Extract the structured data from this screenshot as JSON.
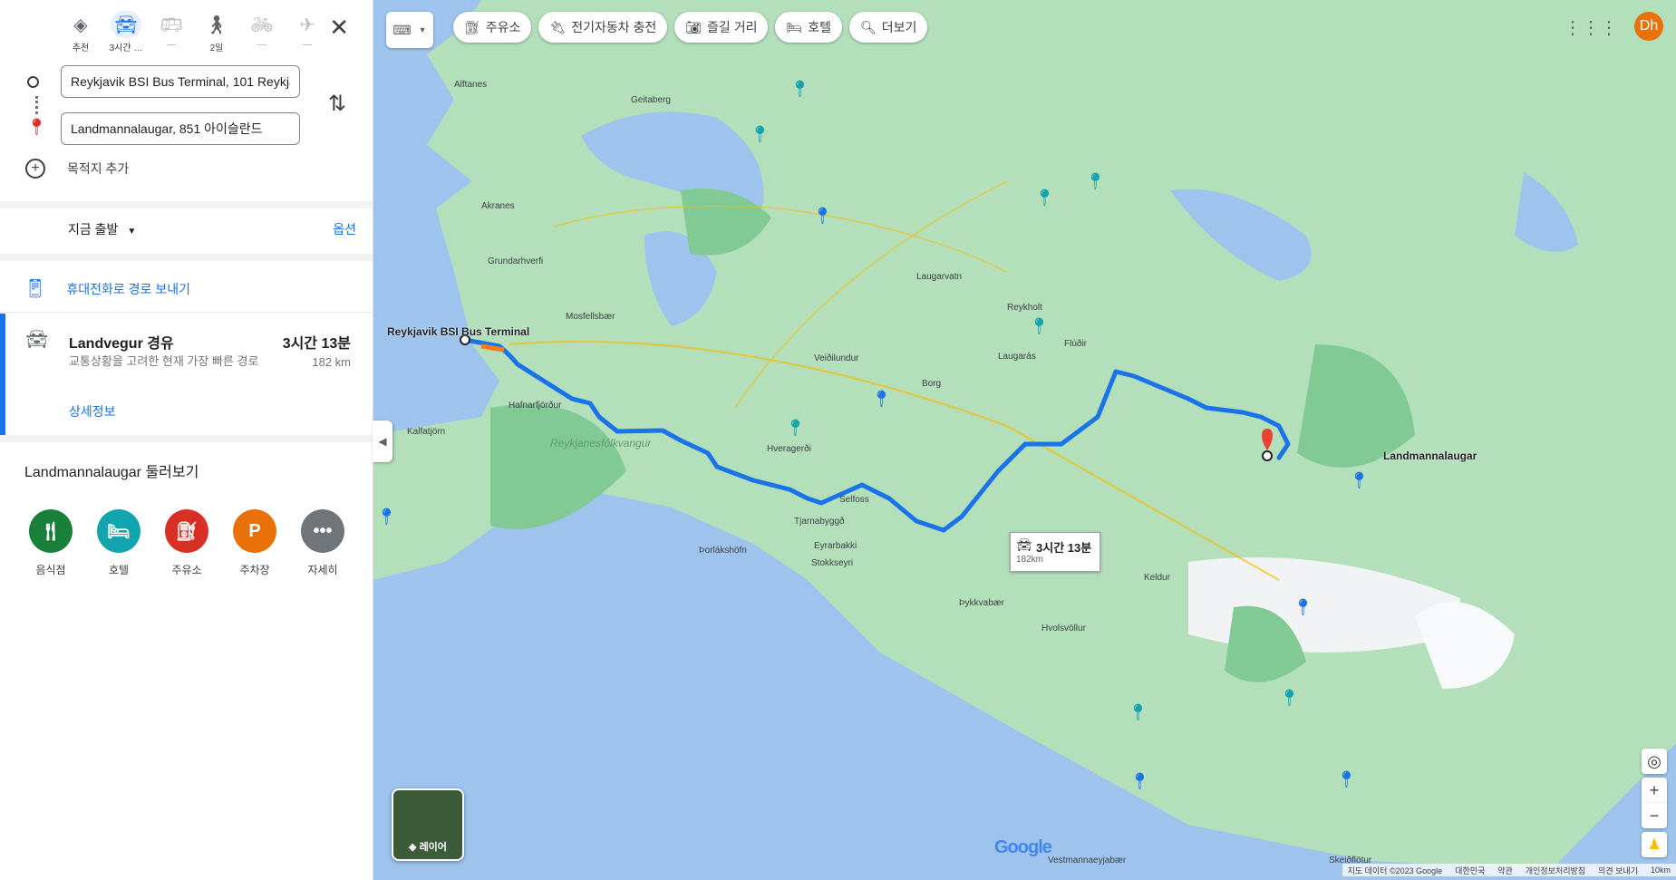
{
  "modes": [
    {
      "name": "best",
      "icon": "diamond-directions-icon",
      "label": "추천"
    },
    {
      "name": "driving",
      "icon": "car-icon",
      "label": "3시간 …"
    },
    {
      "name": "transit",
      "icon": "bus-icon",
      "label": "—"
    },
    {
      "name": "walking",
      "icon": "walking-icon",
      "label": "2일"
    },
    {
      "name": "cycling",
      "icon": "bicycle-icon",
      "label": "—"
    },
    {
      "name": "flight",
      "icon": "airplane-icon",
      "label": "—"
    }
  ],
  "waypoints": {
    "origin": "Reykjavik BSI Bus Terminal, 101 Reykjavík",
    "destination": "Landmannalaugar, 851 아이슬란드"
  },
  "add_destination": "목적지 추가",
  "depart": "지금 출발",
  "options": "옵션",
  "send_to_phone": "휴대전화로 경로 보내기",
  "route": {
    "name": "Landvegur 경유",
    "time": "3시간 13분",
    "distance": "182 km",
    "description": "교통상황을 고려한 현재 가장 빠른 경로",
    "details": "상세정보"
  },
  "explore": {
    "title": "Landmannalaugar 둘러보기",
    "categories": [
      {
        "label": "음식점",
        "color": "#188038",
        "icon": "fork-knife-icon"
      },
      {
        "label": "호텔",
        "color": "#12a4af",
        "icon": "bed-icon"
      },
      {
        "label": "주유소",
        "color": "#d93025",
        "icon": "fuel-icon"
      },
      {
        "label": "주차장",
        "color": "#e8710a",
        "icon": "parking-icon"
      },
      {
        "label": "자세히",
        "color": "#70757a",
        "icon": "more-icon"
      }
    ]
  },
  "chips": [
    {
      "label": "주유소",
      "icon": "fuel-icon"
    },
    {
      "label": "전기자동차 충전",
      "icon": "ev-charger-icon"
    },
    {
      "label": "즐길 거리",
      "icon": "camera-icon"
    },
    {
      "label": "호텔",
      "icon": "bed-icon"
    },
    {
      "label": "더보기",
      "icon": "search-icon"
    }
  ],
  "avatar": "Dh",
  "layers_label": "레이어",
  "tooltip": {
    "time": "3시간 13분",
    "distance": "182km"
  },
  "map_labels": {
    "origin": "Reykjavik BSI Bus Terminal",
    "destination": "Landmannalaugar",
    "places": [
      "Alftanes",
      "Akranes",
      "Mosfellsbær",
      "Hafnarfjörður",
      "Reykjanesfólkvangur",
      "Hveragerði",
      "Selfoss",
      "Tjarnabyggð",
      "Eyrarbakki",
      "Stokkseyri",
      "Þorlákshöfn",
      "Borg",
      "Laugarvatn",
      "Reykholt",
      "Flúðir",
      "Laugarás",
      "Veiðilundur",
      "Grundarhverfi",
      "Geitaberg",
      "Kalfatjörn",
      "Þykkvabær",
      "Hvolsvöllur",
      "Keldur",
      "Vestmannaeyjabær",
      "Skeiðflötur"
    ]
  },
  "attribution": [
    "지도 데이터 ©2023 Google",
    "대한민국",
    "약관",
    "개인정보처리방침",
    "의견 보내기",
    "10km"
  ],
  "colors": {
    "route": "#1a73e8",
    "water": "#9ec4ee",
    "land": "#a8dab5"
  }
}
